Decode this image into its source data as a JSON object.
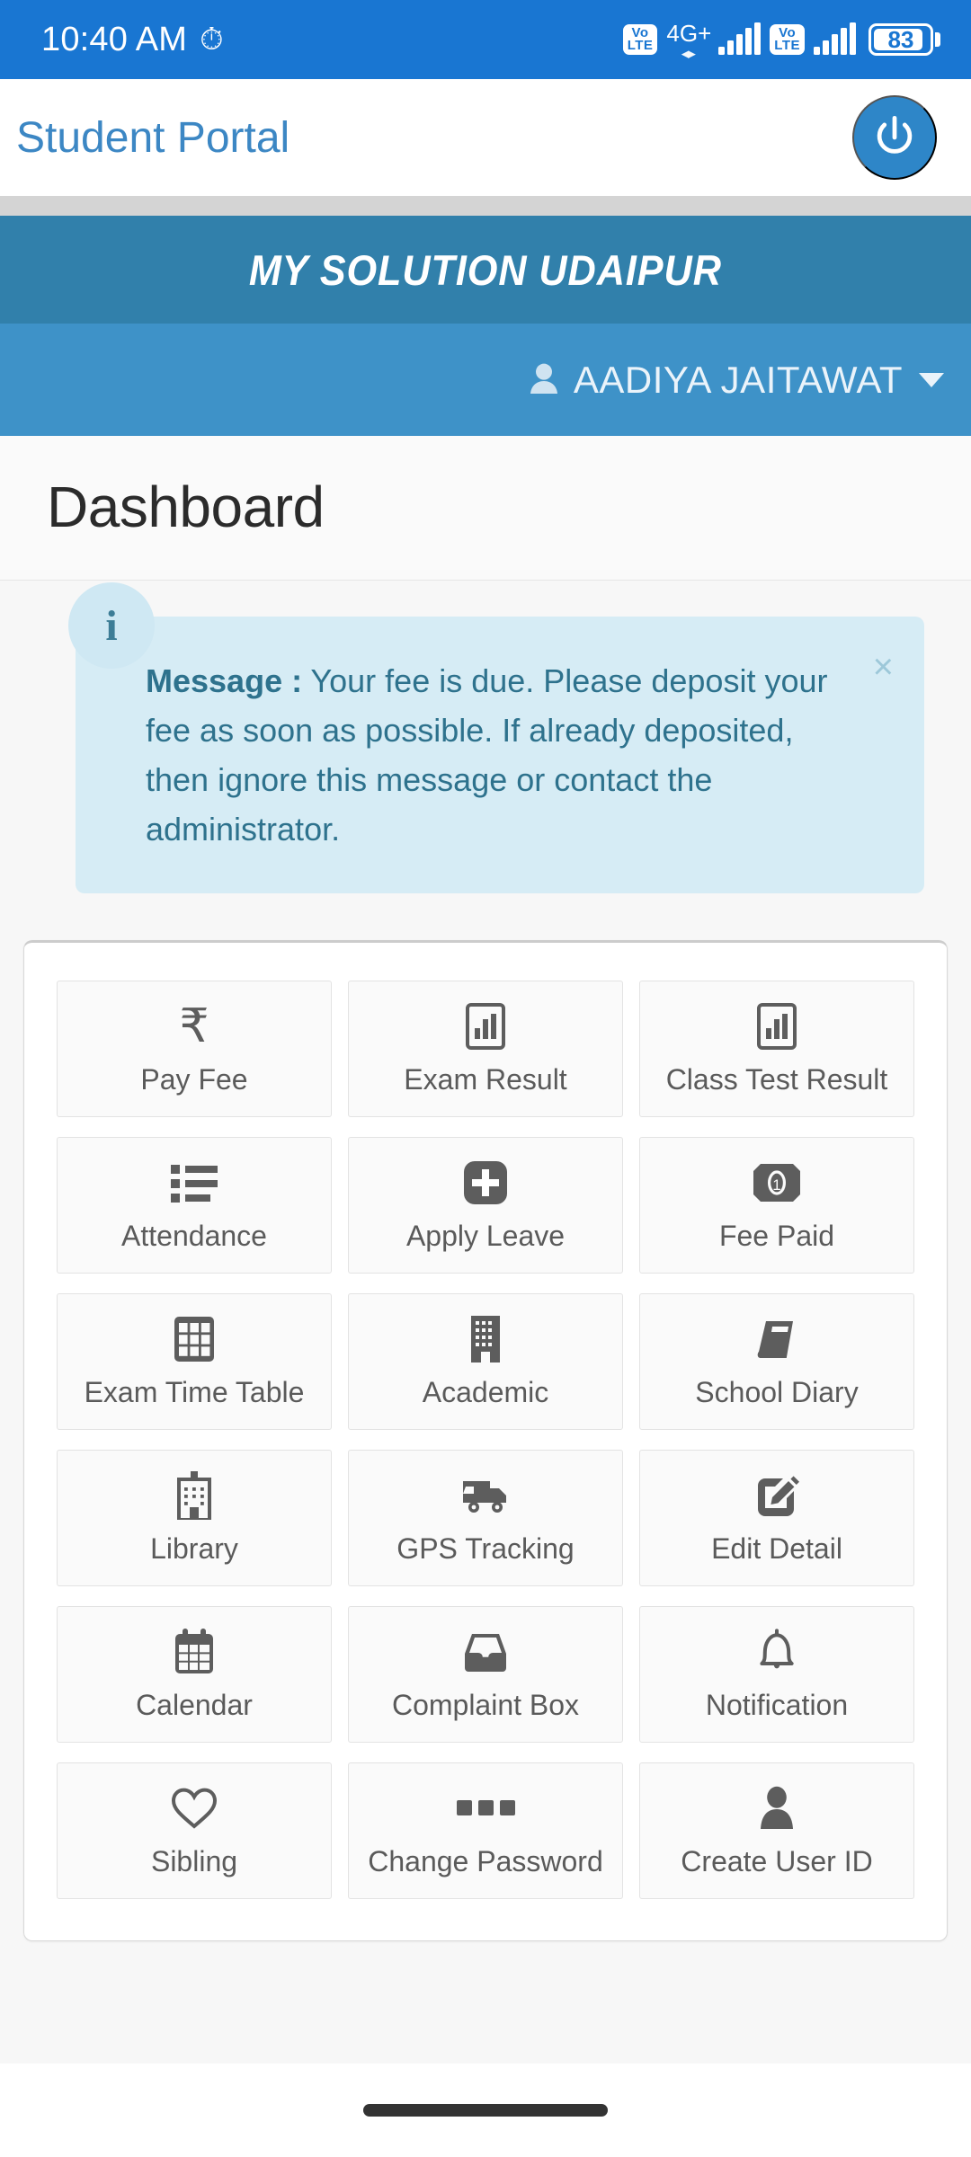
{
  "status_bar": {
    "time": "10:40 AM",
    "alarm_icon": "alarm-icon",
    "sim1_volte": "VoLTE",
    "network_type": "4G+",
    "sim2_volte": "VoLTE",
    "battery_percent": "83"
  },
  "app_bar": {
    "title": "Student Portal",
    "power_icon": "power-icon"
  },
  "school_banner": {
    "name": "MY SOLUTION UDAIPUR"
  },
  "user_bar": {
    "user_icon": "user-icon",
    "name": "AADIYA JAITAWAT",
    "caret_icon": "chevron-down-icon"
  },
  "page": {
    "title": "Dashboard"
  },
  "alert": {
    "info_icon": "info-icon",
    "label": "Message :",
    "text": " Your fee is due. Please deposit your fee as soon as possible. If already deposited, then ignore this message or contact the administrator.",
    "close_label": "×"
  },
  "colors": {
    "status_bar": "#1976d2",
    "app_title": "#3c87c4",
    "banner": "#3180ab",
    "user_bar": "#3e92c8",
    "alert_bg": "#d6ecf5",
    "alert_text": "#2e728d",
    "tile_label": "#5a5a5a"
  },
  "tiles": [
    {
      "label": "Pay Fee",
      "icon": "rupee-icon"
    },
    {
      "label": "Exam Result",
      "icon": "bar-chart-icon"
    },
    {
      "label": "Class Test Result",
      "icon": "bar-chart-icon"
    },
    {
      "label": "Attendance",
      "icon": "list-icon"
    },
    {
      "label": "Apply Leave",
      "icon": "plus-square-icon"
    },
    {
      "label": "Fee Paid",
      "icon": "banknote-icon"
    },
    {
      "label": "Exam Time Table",
      "icon": "table-grid-icon"
    },
    {
      "label": "Academic",
      "icon": "building-icon"
    },
    {
      "label": "School Diary",
      "icon": "book-icon"
    },
    {
      "label": "Library",
      "icon": "library-building-icon"
    },
    {
      "label": "GPS Tracking",
      "icon": "truck-icon"
    },
    {
      "label": "Edit Detail",
      "icon": "pencil-square-icon"
    },
    {
      "label": "Calendar",
      "icon": "calendar-icon"
    },
    {
      "label": "Complaint Box",
      "icon": "inbox-icon"
    },
    {
      "label": "Notification",
      "icon": "bell-icon"
    },
    {
      "label": "Sibling",
      "icon": "heart-icon"
    },
    {
      "label": "Change Password",
      "icon": "ellipsis-icon"
    },
    {
      "label": "Create User ID",
      "icon": "person-icon"
    }
  ]
}
